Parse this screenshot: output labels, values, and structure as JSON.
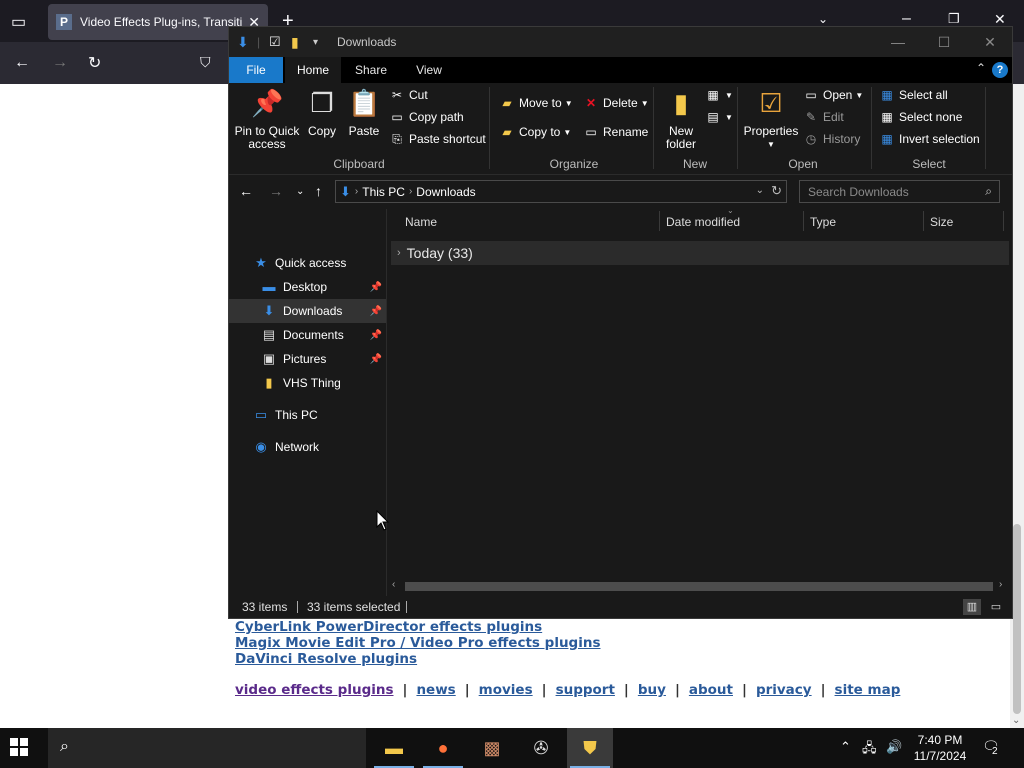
{
  "browser": {
    "tab_title": "Video Effects Plug-ins, Transiti",
    "tab_favicon_letter": "P",
    "icons": [
      "tab-list-icon",
      "back-icon",
      "forward-icon",
      "reload-icon",
      "shield-icon",
      "new-tab-icon",
      "list-tabs-chevron-icon",
      "minimize-icon",
      "restore-icon",
      "close-icon"
    ]
  },
  "webpage": {
    "links": [
      "CyberLink PowerDirector effects plugins",
      "Magix Movie Edit Pro / Video Pro effects plugins",
      "DaVinci Resolve plugins"
    ],
    "footer": [
      "video effects plugins",
      "news",
      "movies",
      "support",
      "buy",
      "about",
      "privacy",
      "site map"
    ],
    "footer_separator": "|"
  },
  "explorer": {
    "title": "Downloads",
    "tabs": [
      "File",
      "Home",
      "Share",
      "View"
    ],
    "help_label": "?",
    "clipboard": {
      "pin_label_1": "Pin to Quick",
      "pin_label_2": "access",
      "copy": "Copy",
      "paste": "Paste",
      "cut": "Cut",
      "copy_path": "Copy path",
      "paste_shortcut": "Paste shortcut",
      "group": "Clipboard"
    },
    "organize": {
      "move_to": "Move to",
      "copy_to": "Copy to",
      "delete": "Delete",
      "rename": "Rename",
      "group": "Organize"
    },
    "new": {
      "new_folder_1": "New",
      "new_folder_2": "folder",
      "group": "New"
    },
    "open": {
      "properties": "Properties",
      "open": "Open",
      "edit": "Edit",
      "history": "History",
      "group": "Open"
    },
    "select": {
      "select_all": "Select all",
      "select_none": "Select none",
      "invert": "Invert selection",
      "group": "Select"
    },
    "address": {
      "crumbs": [
        "This PC",
        "Downloads"
      ],
      "search_placeholder": "Search Downloads"
    },
    "nav": {
      "quick_access": "Quick access",
      "items": [
        "Desktop",
        "Downloads",
        "Documents",
        "Pictures",
        "VHS Thing"
      ],
      "this_pc": "This PC",
      "network": "Network"
    },
    "columns": [
      "Name",
      "Date modified",
      "Type",
      "Size"
    ],
    "group_row": "Today (33)",
    "status": {
      "items": "33 items",
      "selected": "33 items selected"
    }
  },
  "taskbar": {
    "time": "7:40 PM",
    "date": "11/7/2024",
    "notification_count": "2",
    "apps": [
      "file-explorer",
      "firefox",
      "video-editor",
      "media-app",
      "installer"
    ]
  },
  "colors": {
    "accent": "#1979ca",
    "explorer_bg": "#191919",
    "link": "#2a5a9a"
  }
}
